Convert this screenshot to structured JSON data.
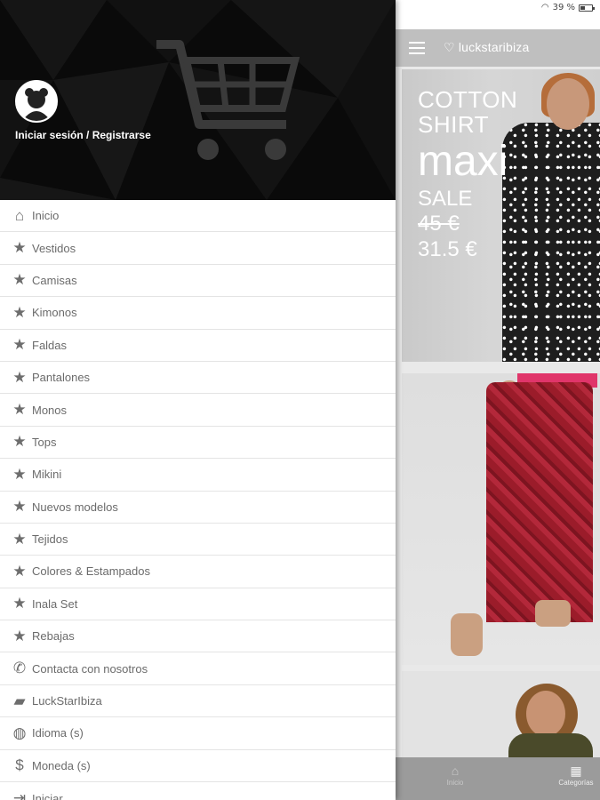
{
  "status": {
    "battery_text": "39 %"
  },
  "appbar": {
    "logo_text": "♡ luckstaribiza"
  },
  "promo": {
    "line1": "COTTON",
    "line2": "SHIRT",
    "big": "maxi",
    "sale": "SALE",
    "old_price": "45 €",
    "new_price": "31.5 €"
  },
  "drawer": {
    "login_label": "Iniciar sesión / Registrarse",
    "items": [
      {
        "label": "Inicio",
        "icon": "home-icon",
        "glyph": "⌂"
      },
      {
        "label": " Vestidos",
        "icon": "star-icon",
        "glyph": "★"
      },
      {
        "label": "Camisas",
        "icon": "star-icon",
        "glyph": "★"
      },
      {
        "label": "Kimonos",
        "icon": "star-icon",
        "glyph": "★"
      },
      {
        "label": "Faldas",
        "icon": "star-icon",
        "glyph": "★"
      },
      {
        "label": "Pantalones",
        "icon": "star-icon",
        "glyph": "★"
      },
      {
        "label": "Monos",
        "icon": "star-icon",
        "glyph": "★"
      },
      {
        "label": "Tops",
        "icon": "star-icon",
        "glyph": "★"
      },
      {
        "label": "Mikini",
        "icon": "star-icon",
        "glyph": "★"
      },
      {
        "label": "Nuevos modelos",
        "icon": "star-icon",
        "glyph": "★"
      },
      {
        "label": "Tejidos",
        "icon": "star-icon",
        "glyph": "★"
      },
      {
        "label": "Colores & Estampados",
        "icon": "star-icon",
        "glyph": "★"
      },
      {
        "label": "Inala Set",
        "icon": "star-icon",
        "glyph": "★"
      },
      {
        "label": "Rebajas",
        "icon": "star-icon",
        "glyph": "★"
      },
      {
        "label": "Contacta con nosotros",
        "icon": "phone-icon",
        "glyph": "✆"
      },
      {
        "label": "LuckStarIbiza",
        "icon": "label-icon",
        "glyph": "▰"
      },
      {
        "label": "Idioma (s)",
        "icon": "globe-icon",
        "glyph": "◍"
      },
      {
        "label": "Moneda (s)",
        "icon": "dollar-icon",
        "glyph": "$"
      },
      {
        "label": "Iniciar",
        "icon": "login-icon",
        "glyph": "⇥"
      }
    ]
  },
  "bottomnav": {
    "home_label": "Inicio",
    "categories_label": "Categorías"
  },
  "colors": {
    "drawer_header": "#0a0a0a",
    "appbar": "#bfbfbf",
    "bottomnav": "#9b9b9b",
    "menu_text": "#6b6b6b"
  }
}
